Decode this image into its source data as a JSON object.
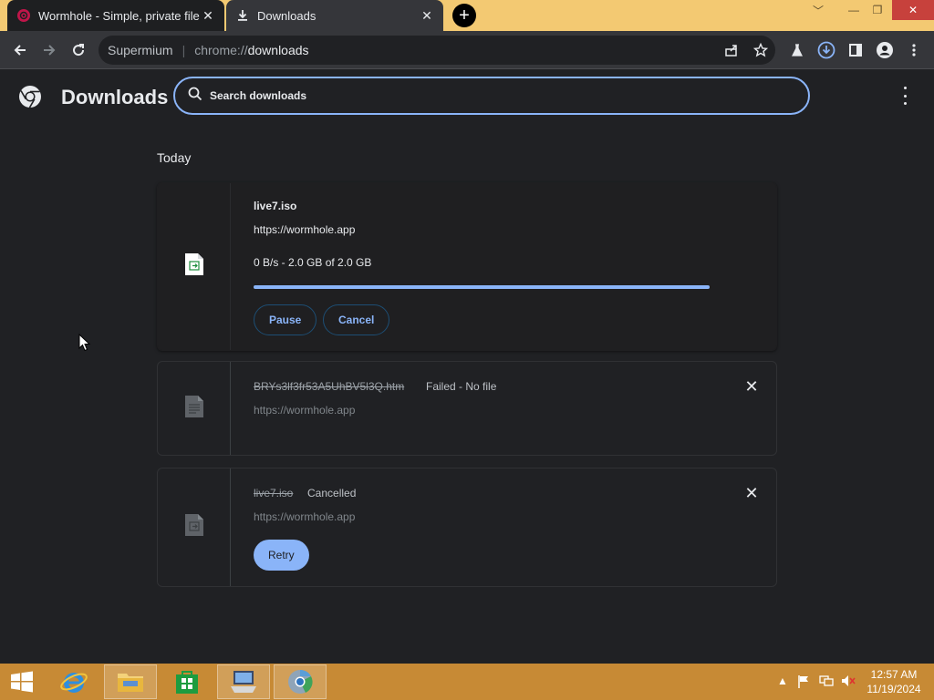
{
  "tabs": [
    {
      "title": "Wormhole - Simple, private file s",
      "icon": "wormhole-icon",
      "active": false
    },
    {
      "title": "Downloads",
      "icon": "download-icon",
      "active": true
    }
  ],
  "window_controls": {
    "minimize": "—",
    "restore": "❐",
    "close": "✕"
  },
  "omnibox": {
    "site": "Supermium",
    "separator": "|",
    "scheme": "chrome://",
    "path": "downloads"
  },
  "page": {
    "title": "Downloads",
    "search_placeholder": "Search downloads",
    "section": "Today"
  },
  "downloads": [
    {
      "filename": "live7.iso",
      "url": "https://wormhole.app",
      "progress_text": "0 B/s - 2.0 GB of 2.0 GB",
      "progress": 1.0,
      "buttons": [
        "Pause",
        "Cancel"
      ]
    },
    {
      "filename": "BRYs3lf3fr53A5UhBV5l3Q.htm",
      "status": "Failed - No file",
      "url": "https://wormhole.app"
    },
    {
      "filename": "live7.iso",
      "status": "Cancelled",
      "url": "https://wormhole.app",
      "button": "Retry"
    }
  ],
  "taskbar": {
    "time": "12:57 AM",
    "date": "11/19/2024"
  },
  "colors": {
    "accent": "#8ab4f8",
    "titlebar": "#f3c972",
    "taskbar": "#c78a35",
    "background": "#202124"
  }
}
